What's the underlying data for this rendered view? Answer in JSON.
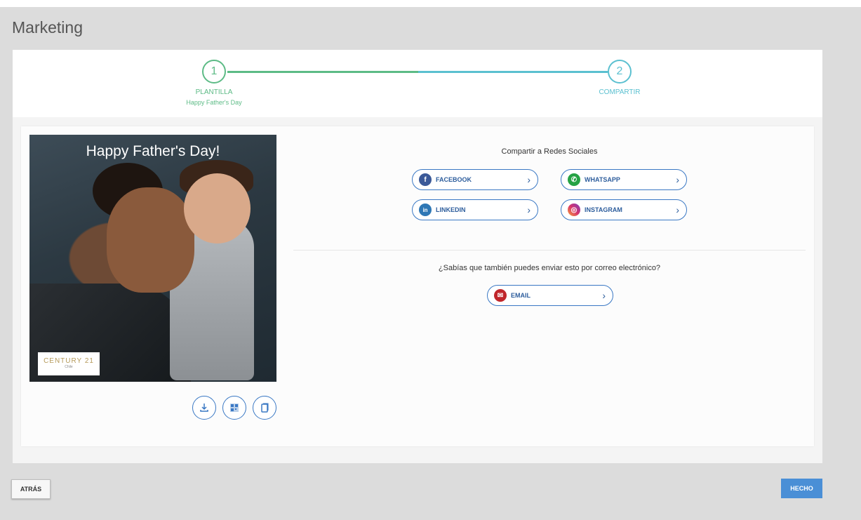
{
  "header": {
    "title": "Marketing"
  },
  "stepper": {
    "steps": [
      {
        "number": "1",
        "label": "PLANTILLA",
        "sublabel": "Happy Father's Day",
        "state": "complete",
        "color": "#5dbb86"
      },
      {
        "number": "2",
        "label": "COMPARTIR",
        "state": "active",
        "color": "#5bc0d0"
      }
    ]
  },
  "preview": {
    "title": "Happy Father's Day!",
    "logo": {
      "text": "CENTURY 21",
      "sub": "Chile"
    },
    "tools": [
      {
        "icon": "download-icon"
      },
      {
        "icon": "qr-code-icon"
      },
      {
        "icon": "copy-icon"
      }
    ]
  },
  "share": {
    "heading": "Compartir a Redes Sociales",
    "buttons": [
      {
        "label": "FACEBOOK",
        "icon": "facebook-icon",
        "color": "#3b5998"
      },
      {
        "label": "WHATSAPP",
        "icon": "whatsapp-icon",
        "color": "#25a244"
      },
      {
        "label": "LINKEDIN",
        "icon": "linkedin-icon",
        "color": "#2e77b5"
      },
      {
        "label": "INSTAGRAM",
        "icon": "instagram-icon",
        "color": "#d8336b"
      }
    ]
  },
  "email": {
    "heading": "¿Sabías que también puedes enviar esto por correo electrónico?",
    "button": {
      "label": "EMAIL",
      "icon": "email-icon",
      "color": "#c0262b"
    }
  },
  "footer": {
    "back_label": "ATRÁS",
    "done_label": "HECHO",
    "done_color": "#4a8fd6"
  }
}
